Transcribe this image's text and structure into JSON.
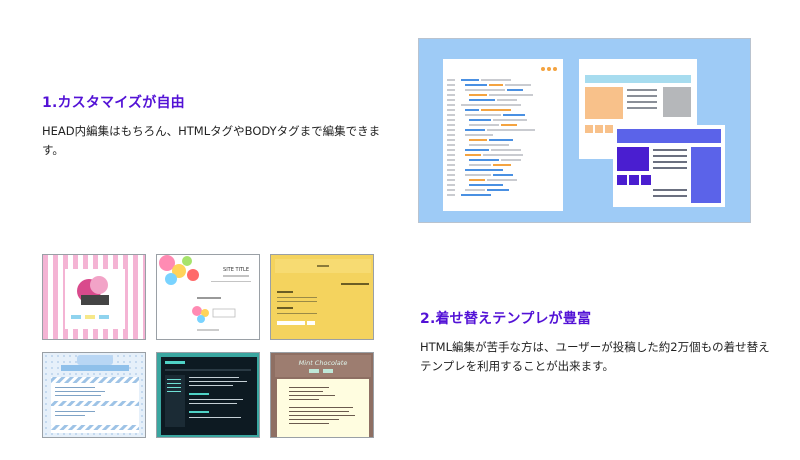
{
  "feature1": {
    "heading": "1.カスタマイズが自由",
    "description": "HEAD内編集はもちろん、HTMLタグやBODYタグまで編集できます。"
  },
  "feature2": {
    "heading": "2.着せ替えテンプレが豊富",
    "description": "HTML編集が苦手な方は、ユーザーが投稿した約2万個もの着せ替えテンプレを利用することが出来ます。"
  },
  "templates": {
    "t2_title": "SITE TITLE",
    "t6_title": "Mint Chocolate"
  },
  "colors": {
    "heading": "#5312d6",
    "hero_bg": "#9ecbf6"
  }
}
